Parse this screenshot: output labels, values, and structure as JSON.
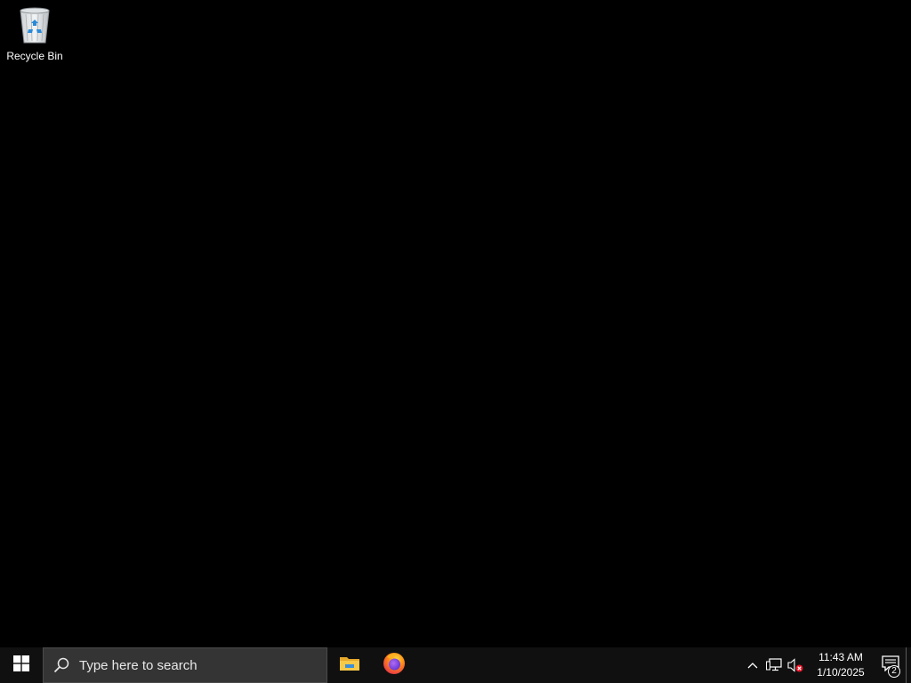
{
  "desktop": {
    "background_color": "#000000",
    "icons": [
      {
        "label": "Recycle Bin",
        "icon": "recycle-bin-icon"
      }
    ]
  },
  "taskbar": {
    "background_color": "#101010",
    "start": {
      "icon": "windows-logo-icon"
    },
    "search": {
      "placeholder": "Type here to search",
      "icon": "search-icon"
    },
    "pinned_apps": [
      {
        "name": "File Explorer",
        "icon": "file-explorer-icon"
      },
      {
        "name": "Firefox",
        "icon": "firefox-icon"
      }
    ],
    "tray": {
      "icons": [
        "chevron-up-icon",
        "network-icon",
        "volume-muted-icon"
      ],
      "clock": {
        "time": "11:43 AM",
        "date": "1/10/2025"
      },
      "notifications": {
        "icon": "action-center-icon",
        "count": "2"
      }
    }
  }
}
